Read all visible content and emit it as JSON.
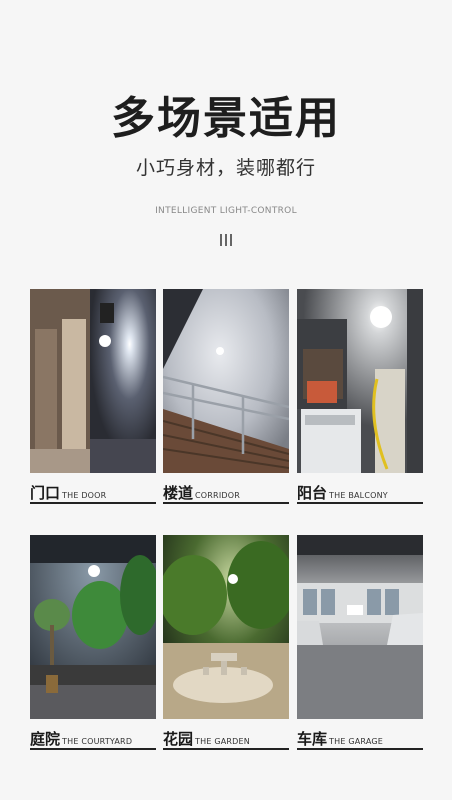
{
  "header": {
    "title": "多场景适用",
    "subtitle": "小巧身材，装哪都行",
    "tagline": "INTELLIGENT LIGHT-CONTROL"
  },
  "scenes": [
    {
      "cn": "门口",
      "en": "THE DOOR"
    },
    {
      "cn": "楼道",
      "en": "CORRIDOR"
    },
    {
      "cn": "阳台",
      "en": "THE BALCONY"
    },
    {
      "cn": "庭院",
      "en": "THE COURTYARD"
    },
    {
      "cn": "花园",
      "en": "THE GARDEN"
    },
    {
      "cn": "车库",
      "en": "THE GARAGE"
    }
  ]
}
